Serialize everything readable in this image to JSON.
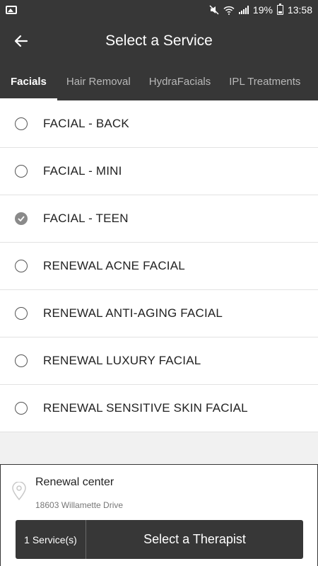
{
  "status_bar": {
    "battery": "19%",
    "time": "13:58",
    "icons": [
      "image-icon",
      "mute-icon",
      "wifi-icon",
      "signal-icon",
      "battery-icon"
    ]
  },
  "header": {
    "title": "Select a Service",
    "back_icon": "arrow-left-icon"
  },
  "tabs": [
    {
      "label": "Facials",
      "active": true
    },
    {
      "label": "Hair Removal",
      "active": false
    },
    {
      "label": "HydraFacials",
      "active": false
    },
    {
      "label": "IPL Treatments",
      "active": false
    }
  ],
  "services": [
    {
      "label": "FACIAL - BACK",
      "selected": false
    },
    {
      "label": "FACIAL - MINI",
      "selected": false
    },
    {
      "label": "FACIAL - TEEN",
      "selected": true
    },
    {
      "label": "RENEWAL ACNE FACIAL",
      "selected": false
    },
    {
      "label": "RENEWAL ANTI-AGING FACIAL",
      "selected": false
    },
    {
      "label": "RENEWAL LUXURY FACIAL",
      "selected": false
    },
    {
      "label": "RENEWAL SENSITIVE SKIN FACIAL",
      "selected": false
    }
  ],
  "location": {
    "name": "Renewal center",
    "address": "18603 Willamette Drive",
    "icon": "map-pin-icon"
  },
  "footer": {
    "count_label": "1 Service(s)",
    "cta_label": "Select a Therapist"
  },
  "colors": {
    "bar": "#373737",
    "selected_radio": "#8a8a8a"
  }
}
